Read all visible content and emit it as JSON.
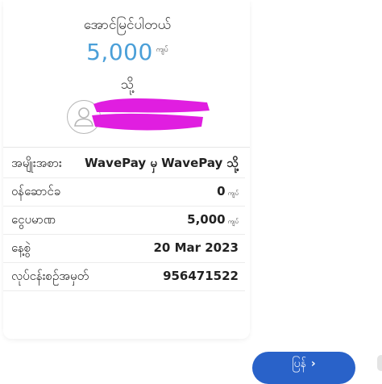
{
  "status_title": "အောင်မြင်ပါတယ်",
  "amount": "5,000",
  "currency": "ကျပ်",
  "to_label": "သို့",
  "details": [
    {
      "label": "အမျိုးအစား",
      "value": "WavePay မှ WavePay သို့",
      "unit": ""
    },
    {
      "label": "ဝန်ဆောင်ခ",
      "value": "0",
      "unit": "ကျပ်"
    },
    {
      "label": "ငွေပမာဏ",
      "value": "5,000",
      "unit": "ကျပ်"
    },
    {
      "label": "နေ့စွဲ",
      "value": "20 Mar 2023",
      "unit": ""
    },
    {
      "label": "လုပ်ငန်းစဉ်အမှတ်",
      "value": "956471522",
      "unit": ""
    }
  ],
  "button_label": "ပြန်",
  "colors": {
    "amount": "#4a9fd8",
    "redaction": "#e01ee0",
    "button": "#2962c9"
  },
  "icons": {
    "avatar": "user-avatar-icon",
    "button_arrow": "arrow-right-icon"
  }
}
